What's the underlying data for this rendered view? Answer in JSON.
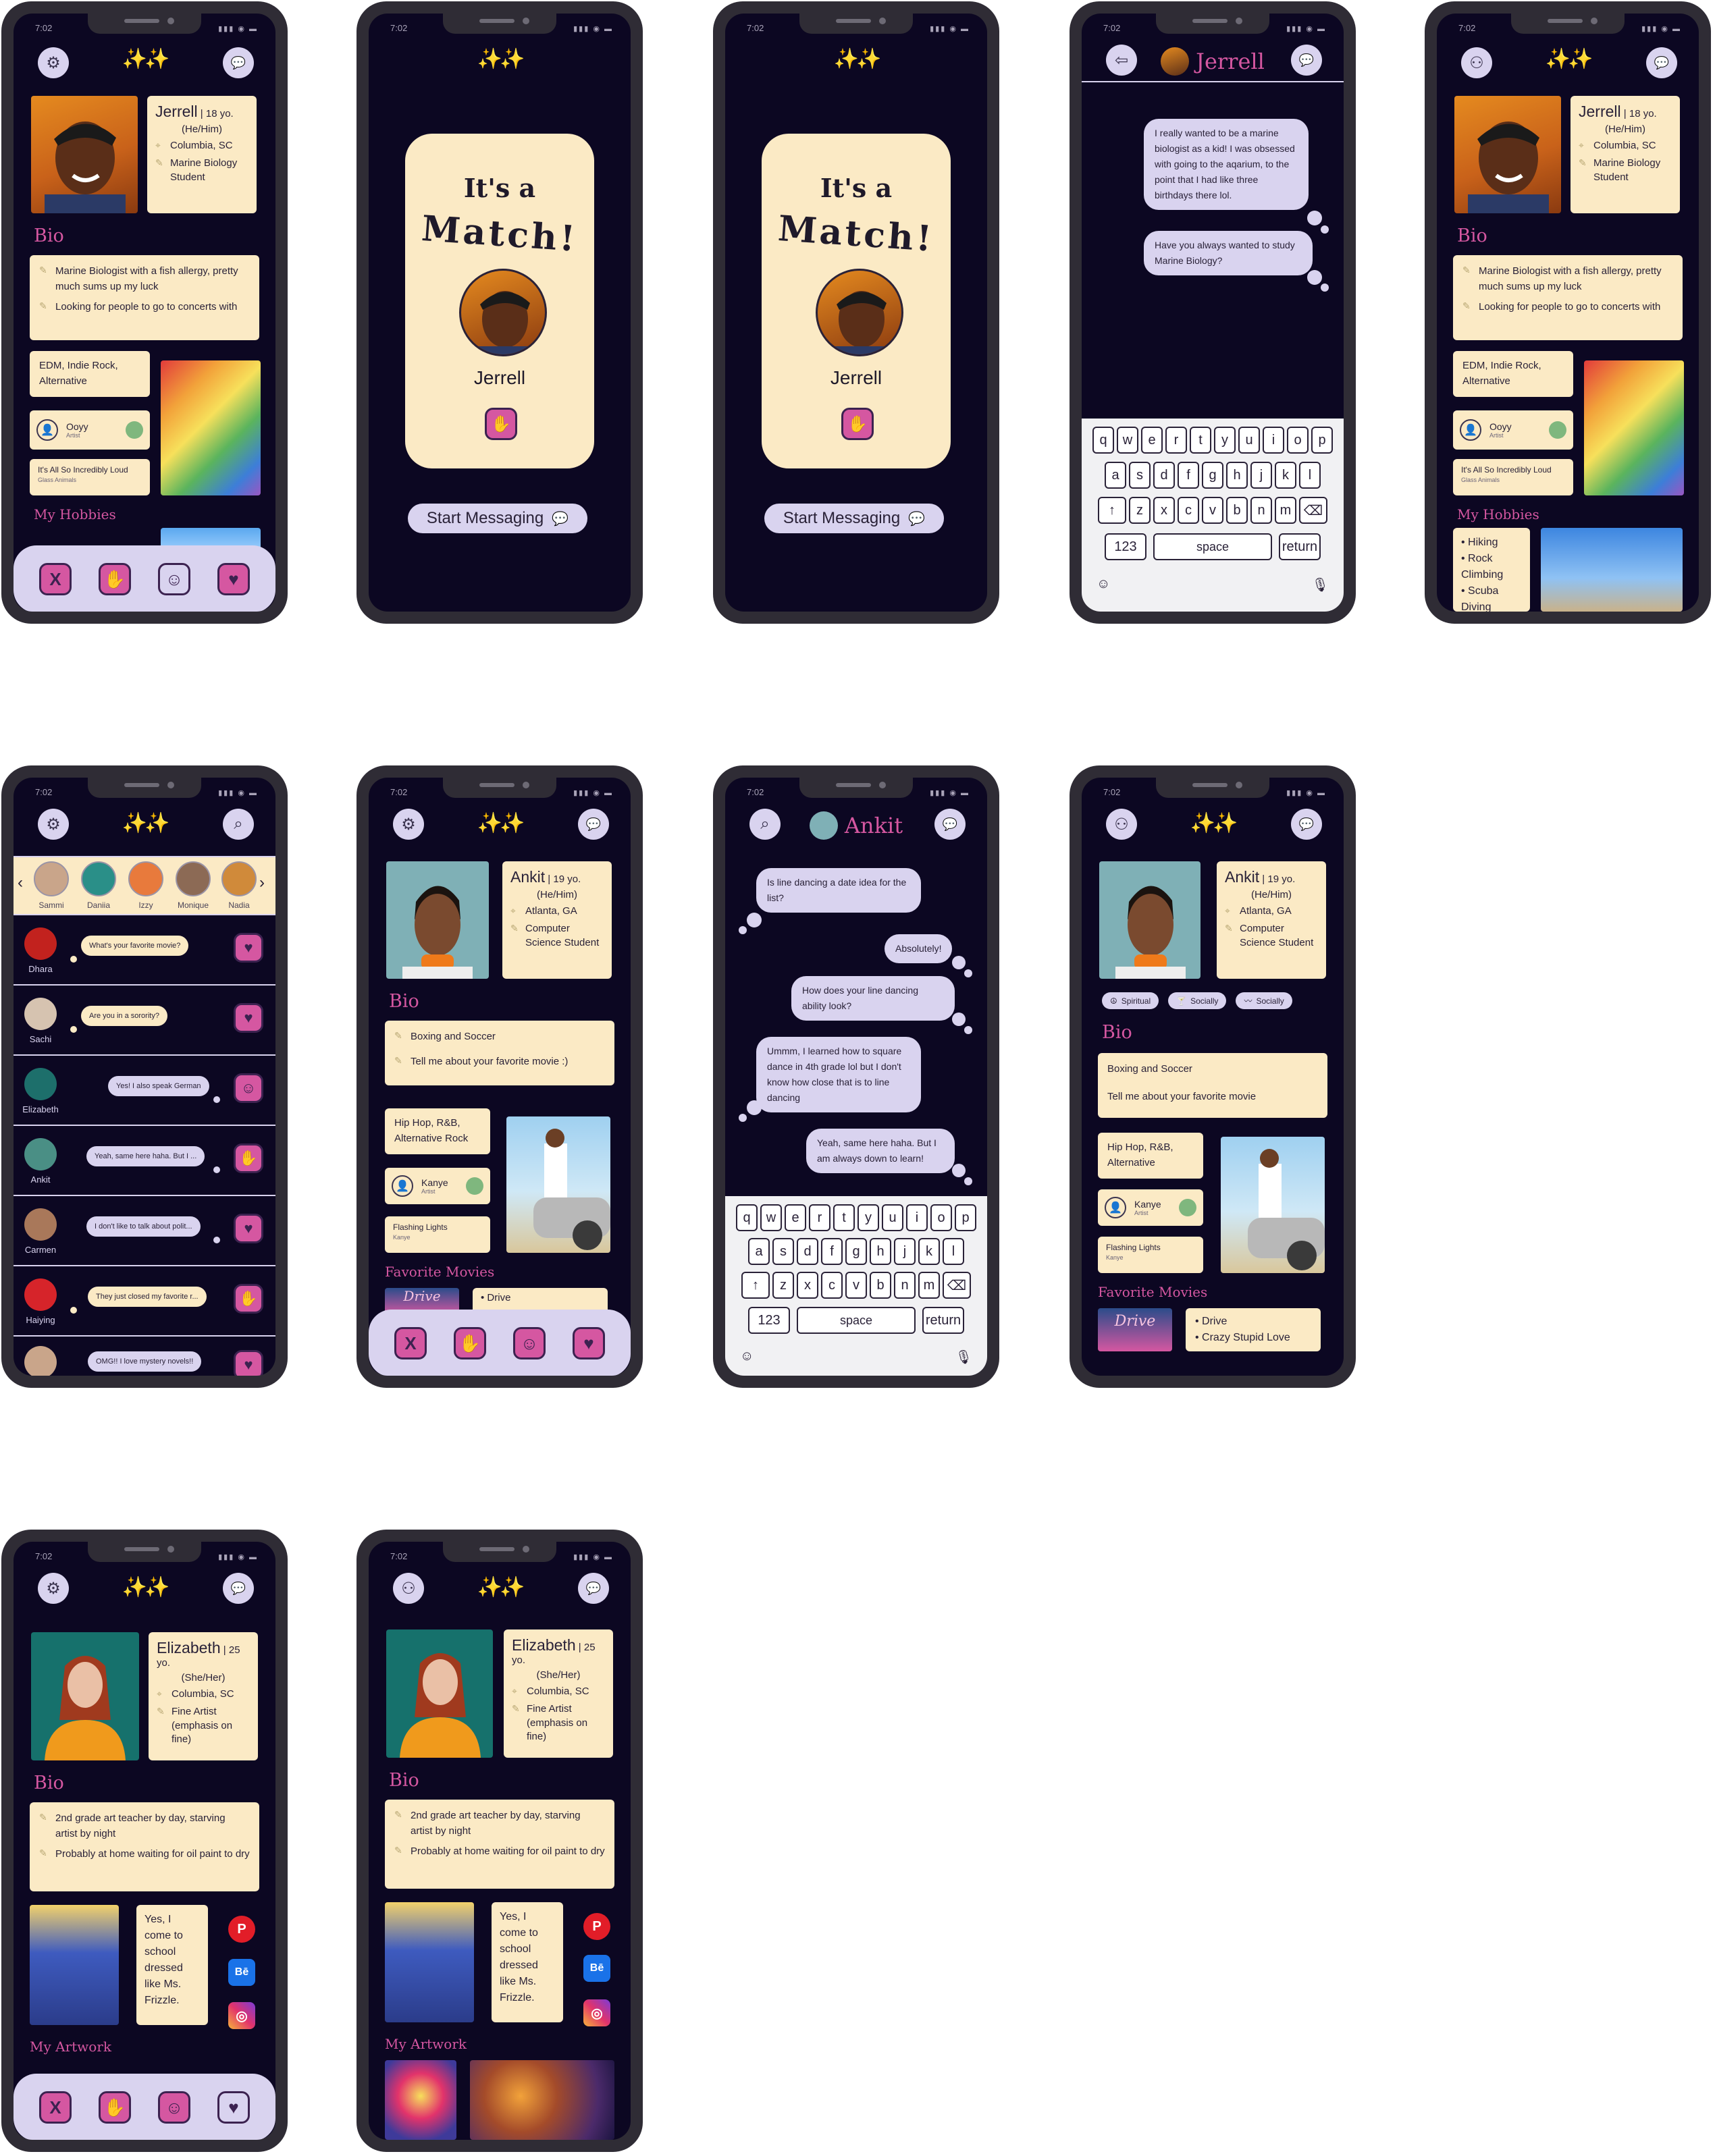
{
  "status": {
    "time": "7:02",
    "indicators": "▮▮▮ ◉ ▬"
  },
  "logo": "✨✨",
  "jerrell": {
    "name": "Jerrell",
    "age": " | 18 yo.",
    "pronouns": "(He/Him)",
    "location": "Columbia, SC",
    "occupation": "Marine Biology Student",
    "bio_title": "Bio",
    "bio": [
      "Marine Biologist with a fish allergy, pretty much sums up my luck",
      "Looking for people to go to concerts with"
    ],
    "music": "EDM, Indie Rock, Alternative",
    "artist": {
      "name": "Ooyy",
      "sub": "Artist"
    },
    "song": {
      "title": "It's All So Incredibly Loud",
      "artist": "Glass Animals"
    },
    "hobbies_title": "My Hobbies",
    "hobbies": [
      "Hiking",
      "Rock Climbing",
      "Scuba Diving"
    ]
  },
  "match": {
    "its_a": "It's a",
    "match_word": "Match!",
    "name": "Jerrell",
    "start_label": "Start Messaging"
  },
  "jerrell_chat": {
    "name": "Jerrell",
    "messages": [
      "I really wanted to be a marine biologist as a kid! I was obsessed with going to the aqarium, to the point that I had like three birthdays there lol.",
      "Have you always wanted to study Marine Biology?"
    ]
  },
  "keyboard": {
    "row1": [
      "q",
      "w",
      "e",
      "r",
      "t",
      "y",
      "u",
      "i",
      "o",
      "p"
    ],
    "row2": [
      "a",
      "s",
      "d",
      "f",
      "g",
      "h",
      "j",
      "k",
      "l"
    ],
    "row3": [
      "z",
      "x",
      "c",
      "v",
      "b",
      "n",
      "m"
    ],
    "shift": "↑",
    "backspace": "⌫",
    "num": "123",
    "space": "space",
    "return": "return",
    "emoji": "☺",
    "mic": "🎙"
  },
  "messages_list": {
    "stories": [
      "Sammi",
      "Daniia",
      "Izzy",
      "Monique",
      "Nadia"
    ],
    "conversations": [
      {
        "name": "Dhara",
        "message": "What's your favorite movie?",
        "action": "♥"
      },
      {
        "name": "Sachi",
        "message": "Are you in a sorority?",
        "action": "♥"
      },
      {
        "name": "Elizabeth",
        "message": "Yes! I also speak German",
        "action": "☺"
      },
      {
        "name": "Ankit",
        "message": "Yeah, same here haha.  But I ...",
        "action": "✋"
      },
      {
        "name": "Carmen",
        "message": "I don't like to talk about polit...",
        "action": "♥"
      },
      {
        "name": "Haiying",
        "message": "They just closed my favorite r...",
        "action": "✋"
      },
      {
        "name": "",
        "message": "OMG!! I love mystery novels!!",
        "action": "♥"
      }
    ]
  },
  "ankit": {
    "name": "Ankit",
    "age": " | 19 yo.",
    "pronouns": "(He/Him)",
    "location": "Atlanta, GA",
    "occupation": "Computer Science Student",
    "bio_title": "Bio",
    "bio": [
      "Boxing and Soccer",
      "Tell me about your favorite movie :)"
    ],
    "bio_plain": [
      "Boxing and Soccer",
      "Tell me about your favorite movie"
    ],
    "music": "Hip Hop, R&B, Alternative Rock",
    "music_short": "Hip Hop, R&B, Alternative",
    "artist": {
      "name": "Kanye",
      "sub": "Artist"
    },
    "song": {
      "title": "Flashing Lights",
      "artist": "Kanye"
    },
    "movies_title": "Favorite Movies",
    "movies": [
      "Drive",
      "Crazy Stupid Love"
    ],
    "movie_poster": "Drive",
    "tags": [
      "Spiritual",
      "Socially",
      "Socially"
    ]
  },
  "ankit_chat": {
    "name": "Ankit",
    "messages": [
      "Is line dancing a date idea for the list?",
      "Absolutely!",
      "How does your line dancing ability look?",
      "Ummm, I learned how to square dance in 4th grade lol but I don't know how close that is to line dancing",
      "Yeah, same here haha. But I am always down to learn!"
    ]
  },
  "elizabeth": {
    "name": "Elizabeth",
    "age": " | 25 yo.",
    "pronouns": "(She/Her)",
    "location": "Columbia, SC",
    "occupation": "Fine Artist (emphasis on fine)",
    "bio_title": "Bio",
    "bio": [
      "2nd grade art teacher by day, starving artist by night",
      "Probably at home waiting for oil paint to dry"
    ],
    "quote": "Yes, I come to school dressed like Ms. Frizzle.",
    "artwork_title": "My Artwork",
    "socials": [
      "P",
      "Bē",
      "◎"
    ]
  },
  "actions": {
    "reject": "X",
    "wave": "✋",
    "smile": "☺",
    "like": "♥"
  },
  "icons": {
    "settings": "⚙",
    "chat": "💬",
    "back": "⇦",
    "search": "⌕",
    "friends": "⚇",
    "location": "⌖",
    "occupation": "✎"
  },
  "colors": {
    "bg": "#0c0722",
    "accent": "#d557a1",
    "cream": "#fbeac5",
    "lilac": "#d9d3ef",
    "frame": "#2f2c35"
  }
}
